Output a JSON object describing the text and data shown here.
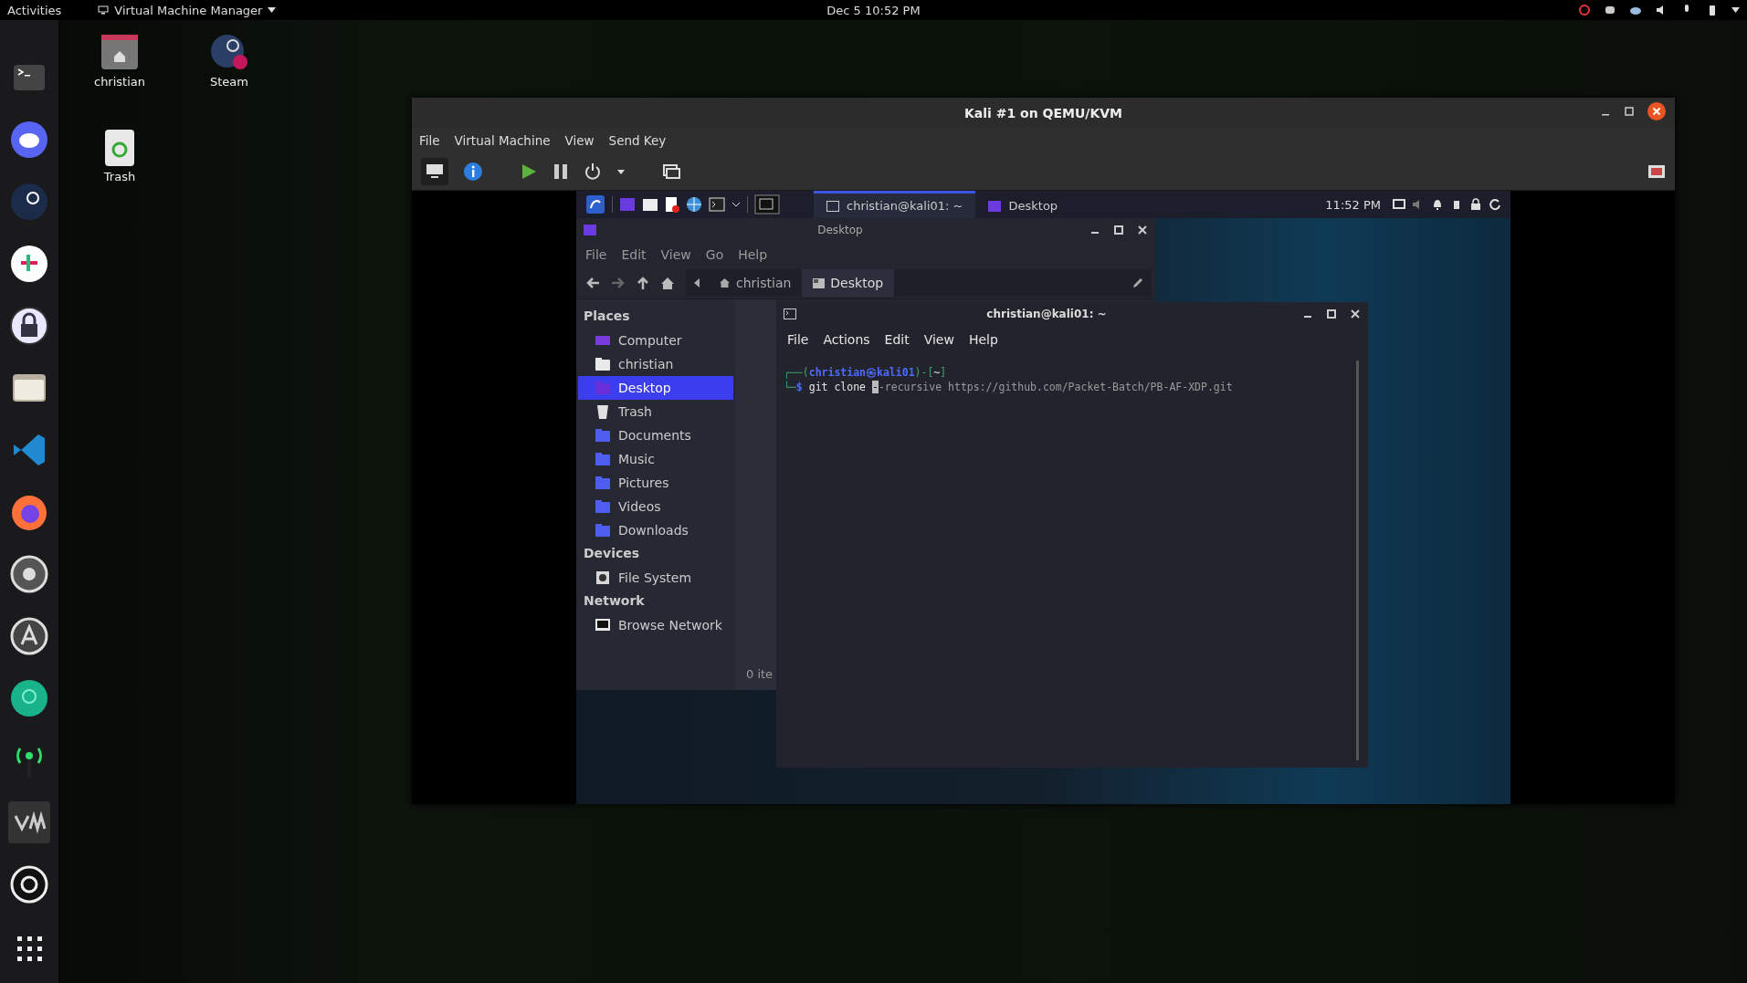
{
  "top_bar": {
    "activities": "Activities",
    "app_menu": "Virtual Machine Manager",
    "clock": "Dec 5  10:52 PM"
  },
  "desktop_icons": [
    {
      "label": "christian",
      "kind": "home"
    },
    {
      "label": "Steam",
      "kind": "shortcut"
    },
    {
      "label": "Trash",
      "kind": "trash"
    }
  ],
  "vm_window": {
    "title": "Kali #1 on QEMU/KVM",
    "menu": [
      "File",
      "Virtual Machine",
      "View",
      "Send Key"
    ],
    "guest": {
      "panel": {
        "tasks": [
          {
            "label": "christian@kali01: ~",
            "selected": true,
            "kind": "terminal"
          },
          {
            "label": "Desktop",
            "selected": false,
            "kind": "folder"
          }
        ],
        "clock": "11:52 PM"
      },
      "file_manager": {
        "title": "Desktop",
        "menu": [
          "File",
          "Edit",
          "View",
          "Go",
          "Help"
        ],
        "path": [
          {
            "label": "christian",
            "kind": "home",
            "selected": false
          },
          {
            "label": "Desktop",
            "kind": "desktop",
            "selected": true
          }
        ],
        "sections": [
          {
            "heading": "Places",
            "items": [
              {
                "label": "Computer",
                "kind": "computer",
                "selected": false
              },
              {
                "label": "christian",
                "kind": "home",
                "selected": false
              },
              {
                "label": "Desktop",
                "kind": "desktop",
                "selected": true
              },
              {
                "label": "Trash",
                "kind": "trash",
                "selected": false
              },
              {
                "label": "Documents",
                "kind": "folder",
                "selected": false
              },
              {
                "label": "Music",
                "kind": "folder",
                "selected": false
              },
              {
                "label": "Pictures",
                "kind": "folder",
                "selected": false
              },
              {
                "label": "Videos",
                "kind": "folder",
                "selected": false
              },
              {
                "label": "Downloads",
                "kind": "folder",
                "selected": false
              }
            ]
          },
          {
            "heading": "Devices",
            "items": [
              {
                "label": "File System",
                "kind": "drive",
                "selected": false
              }
            ]
          },
          {
            "heading": "Network",
            "items": [
              {
                "label": "Browse Network",
                "kind": "network",
                "selected": false
              }
            ]
          }
        ],
        "status": "0 ite"
      },
      "terminal": {
        "title": "christian@kali01: ~",
        "menu": [
          "File",
          "Actions",
          "Edit",
          "View",
          "Help"
        ],
        "prompt": [
          {
            "text": "┌──(",
            "kind": "frame"
          },
          {
            "text": "christian㉿kali01",
            "kind": "user"
          },
          {
            "text": ")-[",
            "kind": "frame"
          },
          {
            "text": "~",
            "kind": "dir"
          },
          {
            "text": "]",
            "kind": "frame"
          }
        ],
        "command": [
          {
            "text": "└─",
            "kind": "frame"
          },
          {
            "text": "$ ",
            "kind": "user"
          },
          {
            "text": "git clone ",
            "kind": "cmd"
          },
          {
            "text": "-",
            "kind": "cursor"
          },
          {
            "text": "-recursive https://github.com/Packet-Batch/PB-AF-XDP.git",
            "kind": "arg"
          }
        ]
      }
    }
  }
}
